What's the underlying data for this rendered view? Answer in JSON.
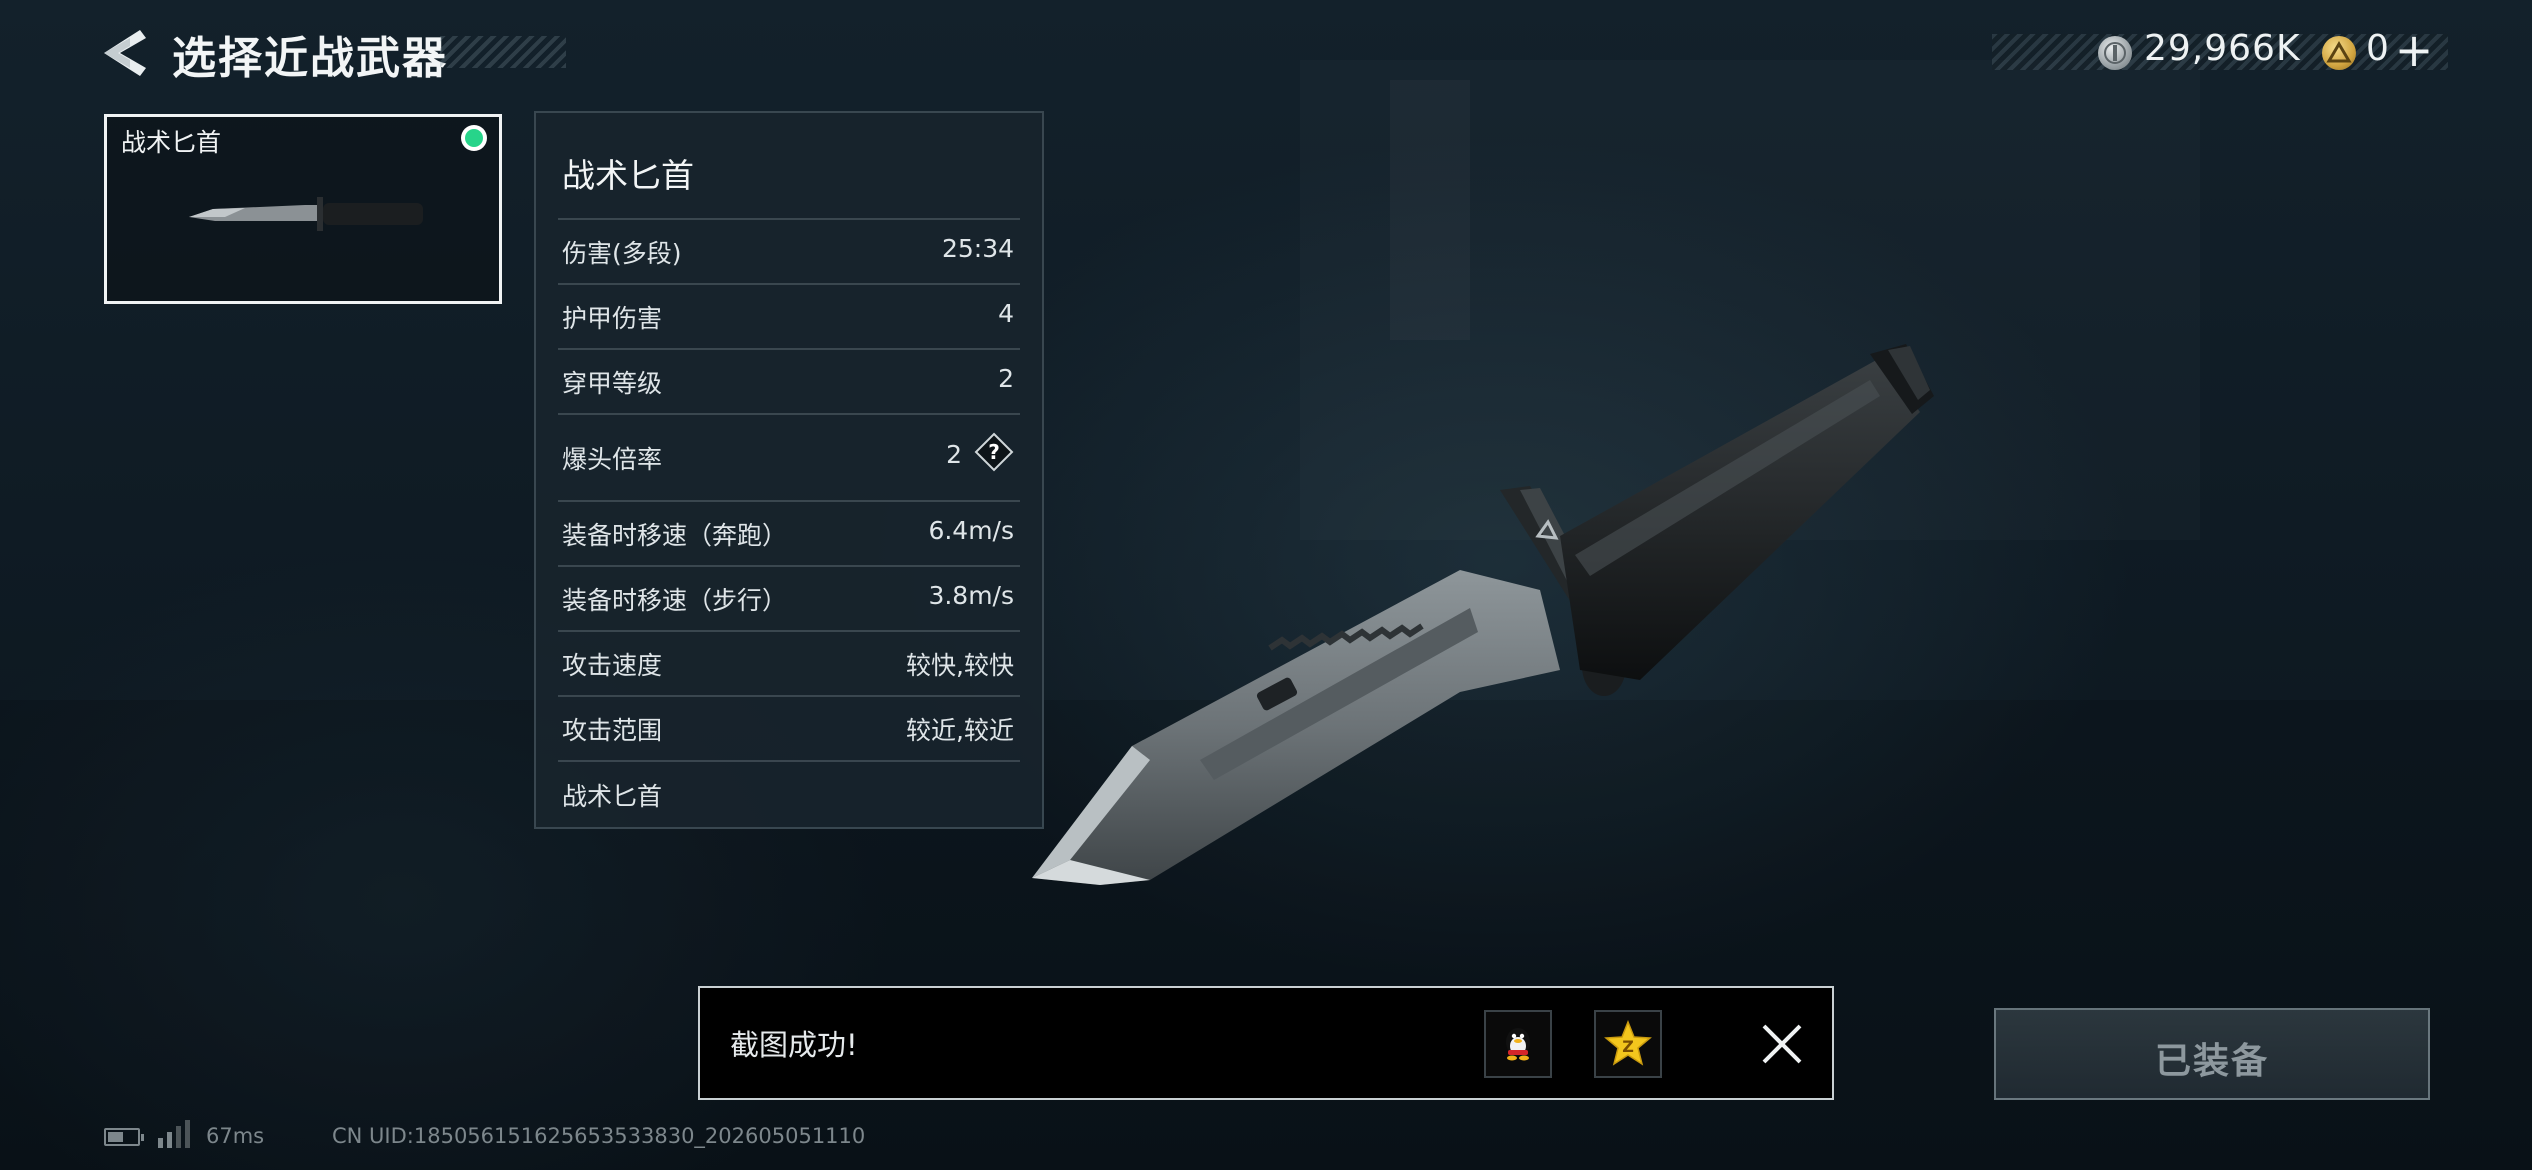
{
  "header": {
    "title": "选择近战武器",
    "back_icon": "back-arrow-icon"
  },
  "currencies": [
    {
      "name": "coin",
      "icon": "silver-coin-icon",
      "value": "29,966K",
      "color": "#b7bdc0"
    },
    {
      "name": "premium",
      "icon": "gold-triangle-coin-icon",
      "value": "0",
      "color": "#d8b04a"
    }
  ],
  "plus_label": "+",
  "weapon_list": [
    {
      "name": "战术匕首",
      "equipped": true,
      "status_color": "#27d48a"
    }
  ],
  "stats_panel": {
    "title": "战术匕首",
    "rows": [
      {
        "label": "伤害(多段)",
        "value": "25:34"
      },
      {
        "label": "护甲伤害",
        "value": "4"
      },
      {
        "label": "穿甲等级",
        "value": "2"
      },
      {
        "label": "爆头倍率",
        "value": "2",
        "help_icon": "question-icon"
      },
      {
        "label": "装备时移速（奔跑）",
        "value": "6.4m/s"
      },
      {
        "label": "装备时移速（步行）",
        "value": "3.8m/s"
      },
      {
        "label": "攻击速度",
        "value": "较快,较快"
      },
      {
        "label": "攻击范围",
        "value": "较近,较近"
      }
    ],
    "footer": "战术匕首"
  },
  "toast": {
    "message": "截图成功!",
    "share_buttons": [
      {
        "name": "qq",
        "icon": "qq-penguin-icon"
      },
      {
        "name": "qzone",
        "icon": "qzone-star-icon"
      }
    ],
    "close_icon": "close-icon"
  },
  "equip_button": {
    "label": "已装备"
  },
  "status_bar": {
    "ping": "67ms",
    "uid": "CN UID:185056151625653533830_202605051110",
    "battery_level": 0.55
  },
  "colors": {
    "accent_green": "#27d48a",
    "panel_bg": "#18242c",
    "background": "#0e1820"
  }
}
